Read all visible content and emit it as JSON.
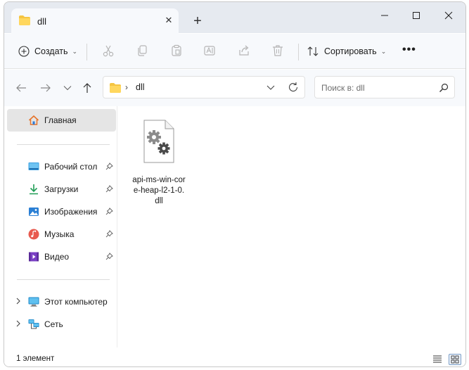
{
  "tab": {
    "title": "dll",
    "close": "✕",
    "new_tab": "+"
  },
  "window_controls": {
    "minimize": "minimize",
    "maximize": "maximize",
    "close": "close"
  },
  "toolbar": {
    "create_label": "Создать",
    "sort_label": "Сортировать",
    "more_label": "•••",
    "icons": [
      "cut-icon",
      "copy-icon",
      "paste-icon",
      "rename-icon",
      "share-icon",
      "delete-icon"
    ]
  },
  "address": {
    "path": "dll",
    "search_placeholder": "Поиск в: dll"
  },
  "sidebar": {
    "home": "Главная",
    "pinned": [
      {
        "label": "Рабочий стол",
        "icon": "desktop-icon"
      },
      {
        "label": "Загрузки",
        "icon": "downloads-icon"
      },
      {
        "label": "Изображения",
        "icon": "pictures-icon"
      },
      {
        "label": "Музыка",
        "icon": "music-icon"
      },
      {
        "label": "Видео",
        "icon": "video-icon"
      }
    ],
    "locations": [
      {
        "label": "Этот компьютер",
        "icon": "this-pc-icon"
      },
      {
        "label": "Сеть",
        "icon": "network-icon"
      }
    ]
  },
  "files": [
    {
      "name": "api-ms-win-core-heap-l2-1-0.dll",
      "icon": "dll-file-icon"
    }
  ],
  "status": {
    "count": "1 элемент"
  },
  "colors": {
    "accent": "#0067c0",
    "folder": "#f5c542",
    "selected_bg": "#e5e5e5"
  }
}
